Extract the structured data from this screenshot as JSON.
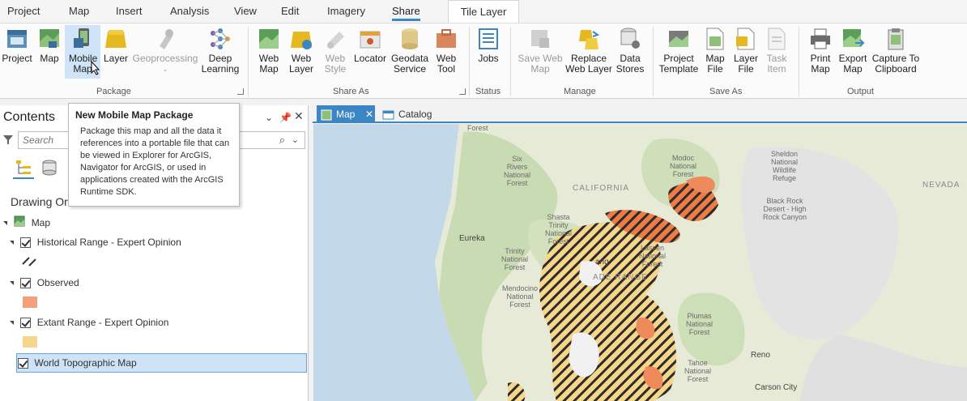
{
  "ribbon_tabs": [
    "Project",
    "Map",
    "Insert",
    "Analysis",
    "View",
    "Edit",
    "Imagery",
    "Share"
  ],
  "active_tab": "Share",
  "contextual_tab": "Tile Layer",
  "groups": {
    "package": {
      "label": "Package",
      "buttons": [
        "Project",
        "Map",
        "Mobile Map",
        "Layer",
        "Geoprocessing",
        "Deep Learning"
      ]
    },
    "share_as": {
      "label": "Share As",
      "buttons": [
        "Web Map",
        "Web Layer",
        "Web Style",
        "Locator",
        "Geodata Service",
        "Web Tool"
      ]
    },
    "status": {
      "label": "Status",
      "buttons": [
        "Jobs"
      ]
    },
    "manage": {
      "label": "Manage",
      "buttons": [
        "Save Web Map",
        "Replace Web Layer",
        "Data Stores"
      ]
    },
    "save_as": {
      "label": "Save As",
      "buttons": [
        "Project Template",
        "Map File",
        "Layer File",
        "Task Item"
      ]
    },
    "output": {
      "label": "Output",
      "buttons": [
        "Print Map",
        "Export Map",
        "Capture To Clipboard"
      ]
    }
  },
  "contents": {
    "title": "Contents",
    "search_placeholder": "Search",
    "drawing_order_label": "Drawing Or",
    "map_name": "Map",
    "layers": [
      "Historical Range - Expert Opinion",
      "Observed",
      "Extant Range - Expert Opinion",
      "World Topographic Map"
    ]
  },
  "tooltip": {
    "title": "New Mobile Map Package",
    "body": "Package this map and all the data it references into a portable file that can be viewed in Explorer for ArcGIS, Navigator for ArcGIS, or used in applications created with the ArcGIS Runtime SDK."
  },
  "view_tabs": [
    "Map",
    "Catalog"
  ],
  "map": {
    "labels": {
      "forest": "Forest",
      "six_rivers": "Six\nRivers\nNational\nForest",
      "modoc": "Modoc\nNational\nForest",
      "sheldon": "Sheldon\nNational\nWildlife\nRefuge",
      "california": "CALIFORNIA",
      "nevada": "NEVADA",
      "black_rock": "Black Rock\nDesert - High\nRock Canyon",
      "shasta": "Shasta\nTrinity\nNational\nForest",
      "eureka": "Eureka",
      "trinity": "Trinity\nNational\nForest",
      "lassen": "Lassen\nNational\nForest",
      "cascade": "ADE RANGE",
      "ang": "ang",
      "mendocino": "Mendocino\nNational\nForest",
      "plumas": "Plumas\nNational\nForest",
      "tahoe": "Tahoe\nNational\nForest",
      "reno": "Reno",
      "carson": "Carson City"
    }
  },
  "colors": {
    "accent": "#3d86c6",
    "observed": "#f3a07c",
    "extant": "#f6d68a",
    "hatch_fill": "#ef7b45"
  }
}
